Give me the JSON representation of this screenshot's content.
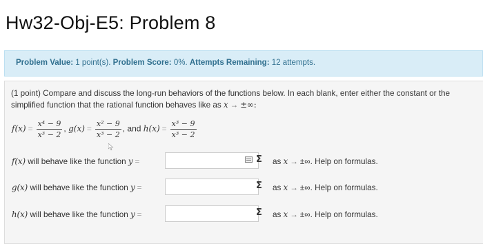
{
  "page": {
    "title": "Hw32-Obj-E5: Problem 8"
  },
  "info_bar": {
    "value_label": "Problem Value:",
    "value": "1 point(s).",
    "score_label": "Problem Score:",
    "score": "0%.",
    "attempts_label": "Attempts Remaining:",
    "attempts": "12 attempts."
  },
  "problem": {
    "intro_prefix": "(1 point) Compare and discuss the long-run behaviors of the functions below. In each blank, enter either the constant or the simplified function that the rational function behaves like as",
    "functions": {
      "f_name": "f(x)",
      "f_num": "x⁴ − 9",
      "f_den": "x³ − 2",
      "g_name": "g(x)",
      "g_num": "x² − 9",
      "g_den": "x³ − 2",
      "and": ", and",
      "h_name": "h(x)",
      "h_num": "x³ − 9",
      "h_den": "x³ − 2"
    },
    "rows": [
      {
        "fn": "f(x)",
        "text": "will behave like the function",
        "var": "y",
        "input_value": "",
        "suffix_var": "x",
        "suffix_text": "±∞. Help on formulas."
      },
      {
        "fn": "g(x)",
        "text": "will behave like the function",
        "var": "y",
        "input_value": "",
        "suffix_var": "x",
        "suffix_text": "±∞. Help on formulas."
      },
      {
        "fn": "h(x)",
        "text": "will behave like the function",
        "var": "y",
        "input_value": "",
        "suffix_var": "x",
        "suffix_text": "±∞. Help on formulas."
      }
    ],
    "as_word": "as",
    "sigma": "Σ"
  },
  "colors": {
    "info_bg": "#d9edf7",
    "info_text": "#31708f",
    "problem_bg": "#f5f5f5"
  },
  "icons": [
    "preview-icon",
    "equation-editor-icon",
    "arrow-icon",
    "mouse-cursor-icon"
  ]
}
